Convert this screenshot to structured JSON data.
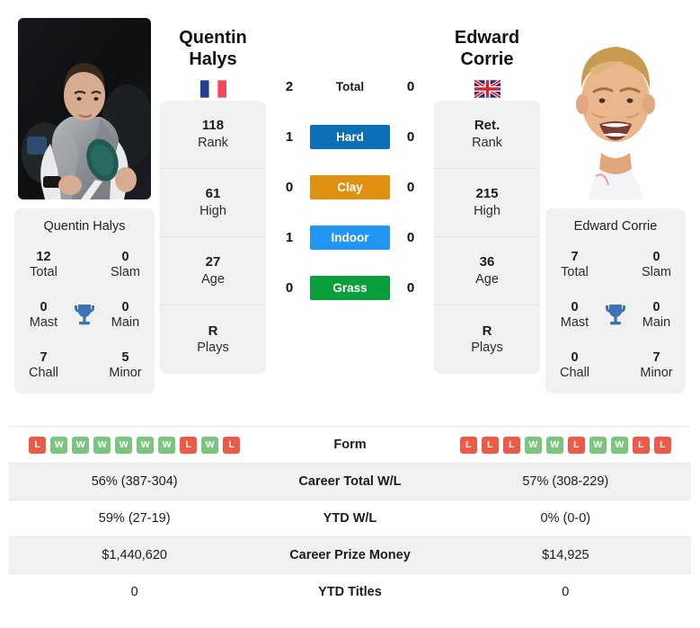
{
  "players": {
    "left": {
      "first_name": "Quentin",
      "last_name": "Halys",
      "full_name": "Quentin Halys",
      "flag": "france-flag-icon",
      "stats": [
        {
          "value": "118",
          "label": "Rank"
        },
        {
          "value": "61",
          "label": "High"
        },
        {
          "value": "27",
          "label": "Age"
        },
        {
          "value": "R",
          "label": "Plays"
        }
      ],
      "titles": [
        {
          "value": "12",
          "label": "Total"
        },
        {
          "value": "0",
          "label": "Slam"
        },
        {
          "value": "0",
          "label": "Mast"
        },
        {
          "value": "0",
          "label": "Main"
        },
        {
          "value": "7",
          "label": "Chall"
        },
        {
          "value": "5",
          "label": "Minor"
        }
      ],
      "form": [
        "L",
        "W",
        "W",
        "W",
        "W",
        "W",
        "W",
        "L",
        "W",
        "L"
      ]
    },
    "right": {
      "first_name": "Edward",
      "last_name": "Corrie",
      "full_name": "Edward Corrie",
      "flag": "uk-flag-icon",
      "stats": [
        {
          "value": "Ret.",
          "label": "Rank"
        },
        {
          "value": "215",
          "label": "High"
        },
        {
          "value": "36",
          "label": "Age"
        },
        {
          "value": "R",
          "label": "Plays"
        }
      ],
      "titles": [
        {
          "value": "7",
          "label": "Total"
        },
        {
          "value": "0",
          "label": "Slam"
        },
        {
          "value": "0",
          "label": "Mast"
        },
        {
          "value": "0",
          "label": "Main"
        },
        {
          "value": "0",
          "label": "Chall"
        },
        {
          "value": "7",
          "label": "Minor"
        }
      ],
      "form": [
        "L",
        "L",
        "L",
        "W",
        "W",
        "L",
        "W",
        "W",
        "L",
        "L"
      ]
    }
  },
  "surfaces": [
    {
      "label": "Total",
      "left": "2",
      "right": "0",
      "color": "none",
      "plain": true
    },
    {
      "label": "Hard",
      "left": "1",
      "right": "0",
      "color": "#0d6eba",
      "plain": false
    },
    {
      "label": "Clay",
      "left": "0",
      "right": "0",
      "color": "#e09112",
      "plain": false
    },
    {
      "label": "Indoor",
      "left": "1",
      "right": "0",
      "color": "#2196f3",
      "plain": false
    },
    {
      "label": "Grass",
      "left": "0",
      "right": "0",
      "color": "#0a9e3d",
      "plain": false
    }
  ],
  "table": {
    "rows": [
      {
        "label": "Form",
        "left": "",
        "right": "",
        "is_form": true
      },
      {
        "label": "Career Total W/L",
        "left": "56% (387-304)",
        "right": "57% (308-229)",
        "is_form": false
      },
      {
        "label": "YTD W/L",
        "left": "59% (27-19)",
        "right": "0% (0-0)",
        "is_form": false
      },
      {
        "label": "Career Prize Money",
        "left": "$1,440,620",
        "right": "$14,925",
        "is_form": false
      },
      {
        "label": "YTD Titles",
        "left": "0",
        "right": "0",
        "is_form": false
      }
    ]
  },
  "colors": {
    "card_bg": "#f1f1f1",
    "win": "#7ac67f",
    "loss": "#eb5b47",
    "trophy": "#3f72b4"
  }
}
